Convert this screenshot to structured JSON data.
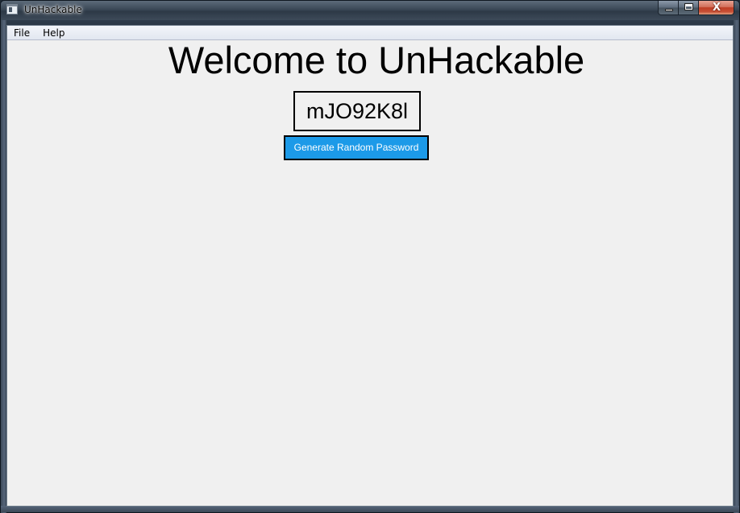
{
  "window": {
    "title": "UnHackable",
    "icons": {
      "app": "app-window-icon",
      "minimize": "minimize-icon",
      "maximize": "maximize-icon",
      "close": "close-icon"
    },
    "close_glyph": "X"
  },
  "menubar": {
    "items": [
      {
        "label": "File"
      },
      {
        "label": "Help"
      }
    ]
  },
  "main": {
    "heading": "Welcome to UnHackable",
    "password": "mJO92K8l",
    "generate_button_label": "Generate Random Password"
  },
  "colors": {
    "button_bg": "#1c9ae8",
    "button_text": "#ffffff",
    "client_bg": "#f0f0f0"
  }
}
